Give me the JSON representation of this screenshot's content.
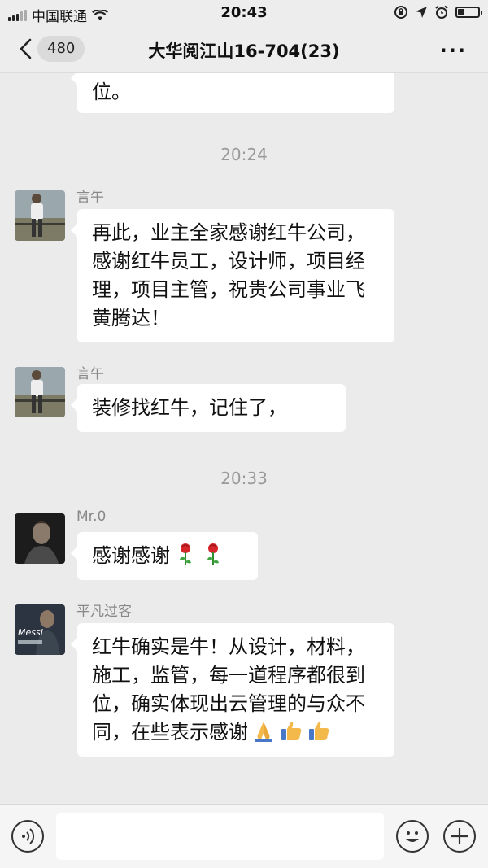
{
  "status_bar": {
    "carrier": "中国联通",
    "time": "20:43"
  },
  "nav": {
    "back_count": "480",
    "title": "大华阅江山16-704(23)",
    "more": "···"
  },
  "messages": {
    "partial_bubble_text": "位。",
    "time_1": "20:24",
    "msg_1": {
      "sender": "言午",
      "text": "再此，业主全家感谢红牛公司，感谢红牛员工，设计师，项目经理，项目主管，祝贵公司事业飞黄腾达！"
    },
    "msg_2": {
      "sender": "言午",
      "text": "装修找红牛，记住了，"
    },
    "time_2": "20:33",
    "msg_3": {
      "sender": "Mr.0",
      "text": "感谢感谢",
      "emojis": [
        "rose-emoji",
        "rose-emoji"
      ]
    },
    "msg_4": {
      "sender": "平凡过客",
      "text": "红牛确实是牛！从设计，材料，施工，监管，每一道程序都很到位，确实体现出云管理的与众不同，在些表示感谢",
      "emojis": [
        "folded-hands-emoji",
        "thumbs-up-emoji",
        "thumbs-up-emoji"
      ],
      "avatar_caption": "Messi"
    }
  },
  "colors": {
    "background": "#ebebeb",
    "bubble": "#ffffff",
    "time_text": "#9a9a9a"
  }
}
